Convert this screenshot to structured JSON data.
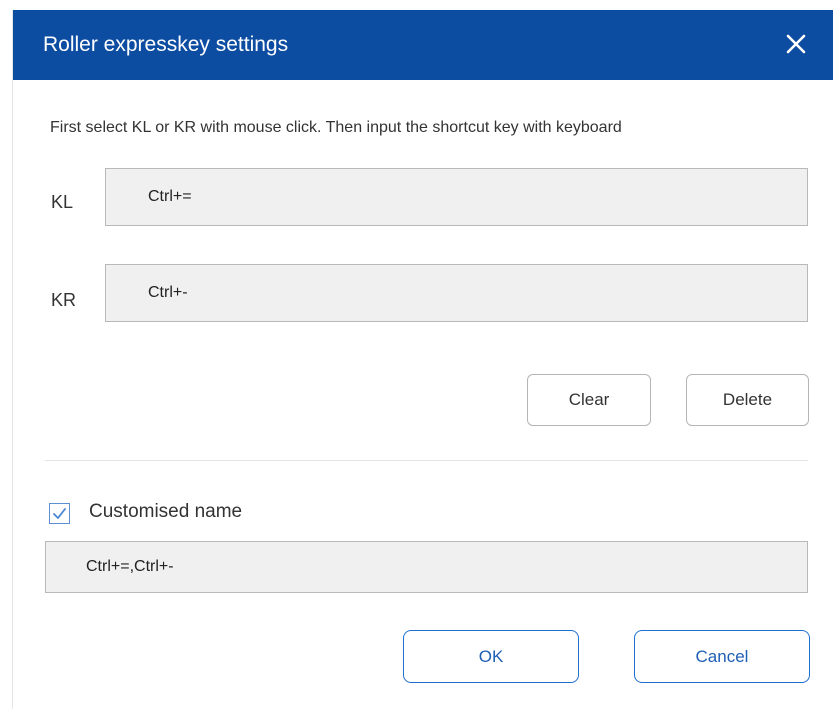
{
  "dialog": {
    "title": "Roller expresskey settings",
    "close_icon": "close-icon",
    "instruction": "First select KL or KR with mouse click. Then input the shortcut key with keyboard"
  },
  "keys": {
    "kl": {
      "label": "KL",
      "value": "Ctrl+="
    },
    "kr": {
      "label": "KR",
      "value": "Ctrl+-"
    }
  },
  "actions": {
    "clear_label": "Clear",
    "delete_label": "Delete"
  },
  "custom_name": {
    "checkbox_label": "Customised name",
    "checked": true,
    "value": "Ctrl+=,Ctrl+-"
  },
  "footer": {
    "ok_label": "OK",
    "cancel_label": "Cancel"
  },
  "colors": {
    "titlebar": "#0c4da2",
    "accent": "#1e6fd0",
    "field_bg": "#f0f0f0"
  }
}
